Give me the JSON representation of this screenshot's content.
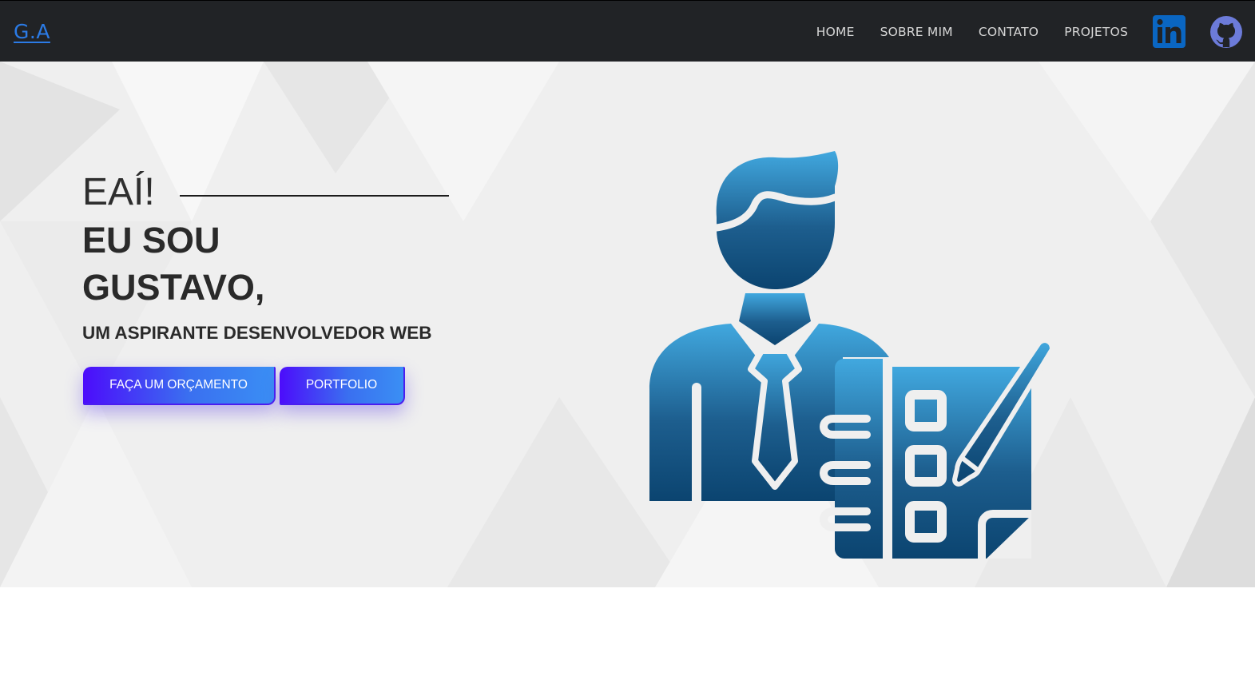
{
  "nav": {
    "logo": "G.A",
    "links": [
      "HOME",
      "SOBRE MIM",
      "CONTATO",
      "PROJETOS"
    ],
    "social": [
      {
        "name": "linkedin",
        "icon": "linkedin-icon",
        "color": "#0a66c2"
      },
      {
        "name": "github",
        "icon": "github-icon",
        "color": "#6c7bd9"
      }
    ]
  },
  "hero": {
    "greeting": "EAÍ!",
    "name_line1": "EU SOU",
    "name_line2": "GUSTAVO,",
    "subtitle": "UM ASPIRANTE DESENVOLVEDOR WEB",
    "buttons": {
      "quote": "FAÇA UM ORÇAMENTO",
      "portfolio": "PORTFOLIO"
    },
    "illustration_icon": "developer-checklist-icon"
  },
  "colors": {
    "navbar": "#212326",
    "logo": "#2b7be6",
    "button_start": "#4c0cfb",
    "button_end": "#3a8ff4",
    "illustration_top": "#41a8df",
    "illustration_bottom": "#0b4470",
    "hero_bg": "#f0f0f0"
  }
}
